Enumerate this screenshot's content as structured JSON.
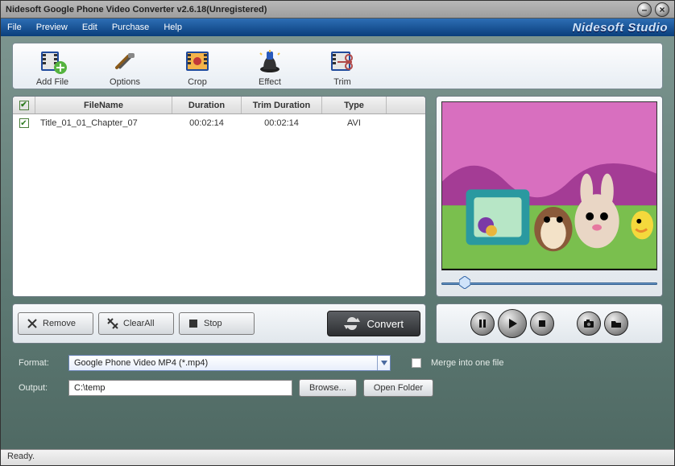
{
  "window": {
    "title": "Nidesoft Google Phone Video Converter v2.6.18(Unregistered)",
    "brand": "Nidesoft Studio"
  },
  "menu": {
    "file": "File",
    "preview": "Preview",
    "edit": "Edit",
    "purchase": "Purchase",
    "help": "Help"
  },
  "toolbar": {
    "addfile": "Add File",
    "options": "Options",
    "crop": "Crop",
    "effect": "Effect",
    "trim": "Trim"
  },
  "grid": {
    "headers": {
      "filename": "FileName",
      "duration": "Duration",
      "trimdur": "Trim Duration",
      "type": "Type"
    },
    "rows": [
      {
        "checked": true,
        "filename": "Title_01_01_Chapter_07",
        "duration": "00:02:14",
        "trimdur": "00:02:14",
        "type": "AVI"
      }
    ]
  },
  "actions": {
    "remove": "Remove",
    "clearall": "ClearAll",
    "stop": "Stop",
    "convert": "Convert"
  },
  "settings": {
    "format_label": "Format:",
    "format_value": "Google Phone Video MP4 (*.mp4)",
    "merge_label": "Merge into one file",
    "output_label": "Output:",
    "output_value": "C:\\temp",
    "browse": "Browse...",
    "openfolder": "Open Folder"
  },
  "status": {
    "text": "Ready."
  }
}
